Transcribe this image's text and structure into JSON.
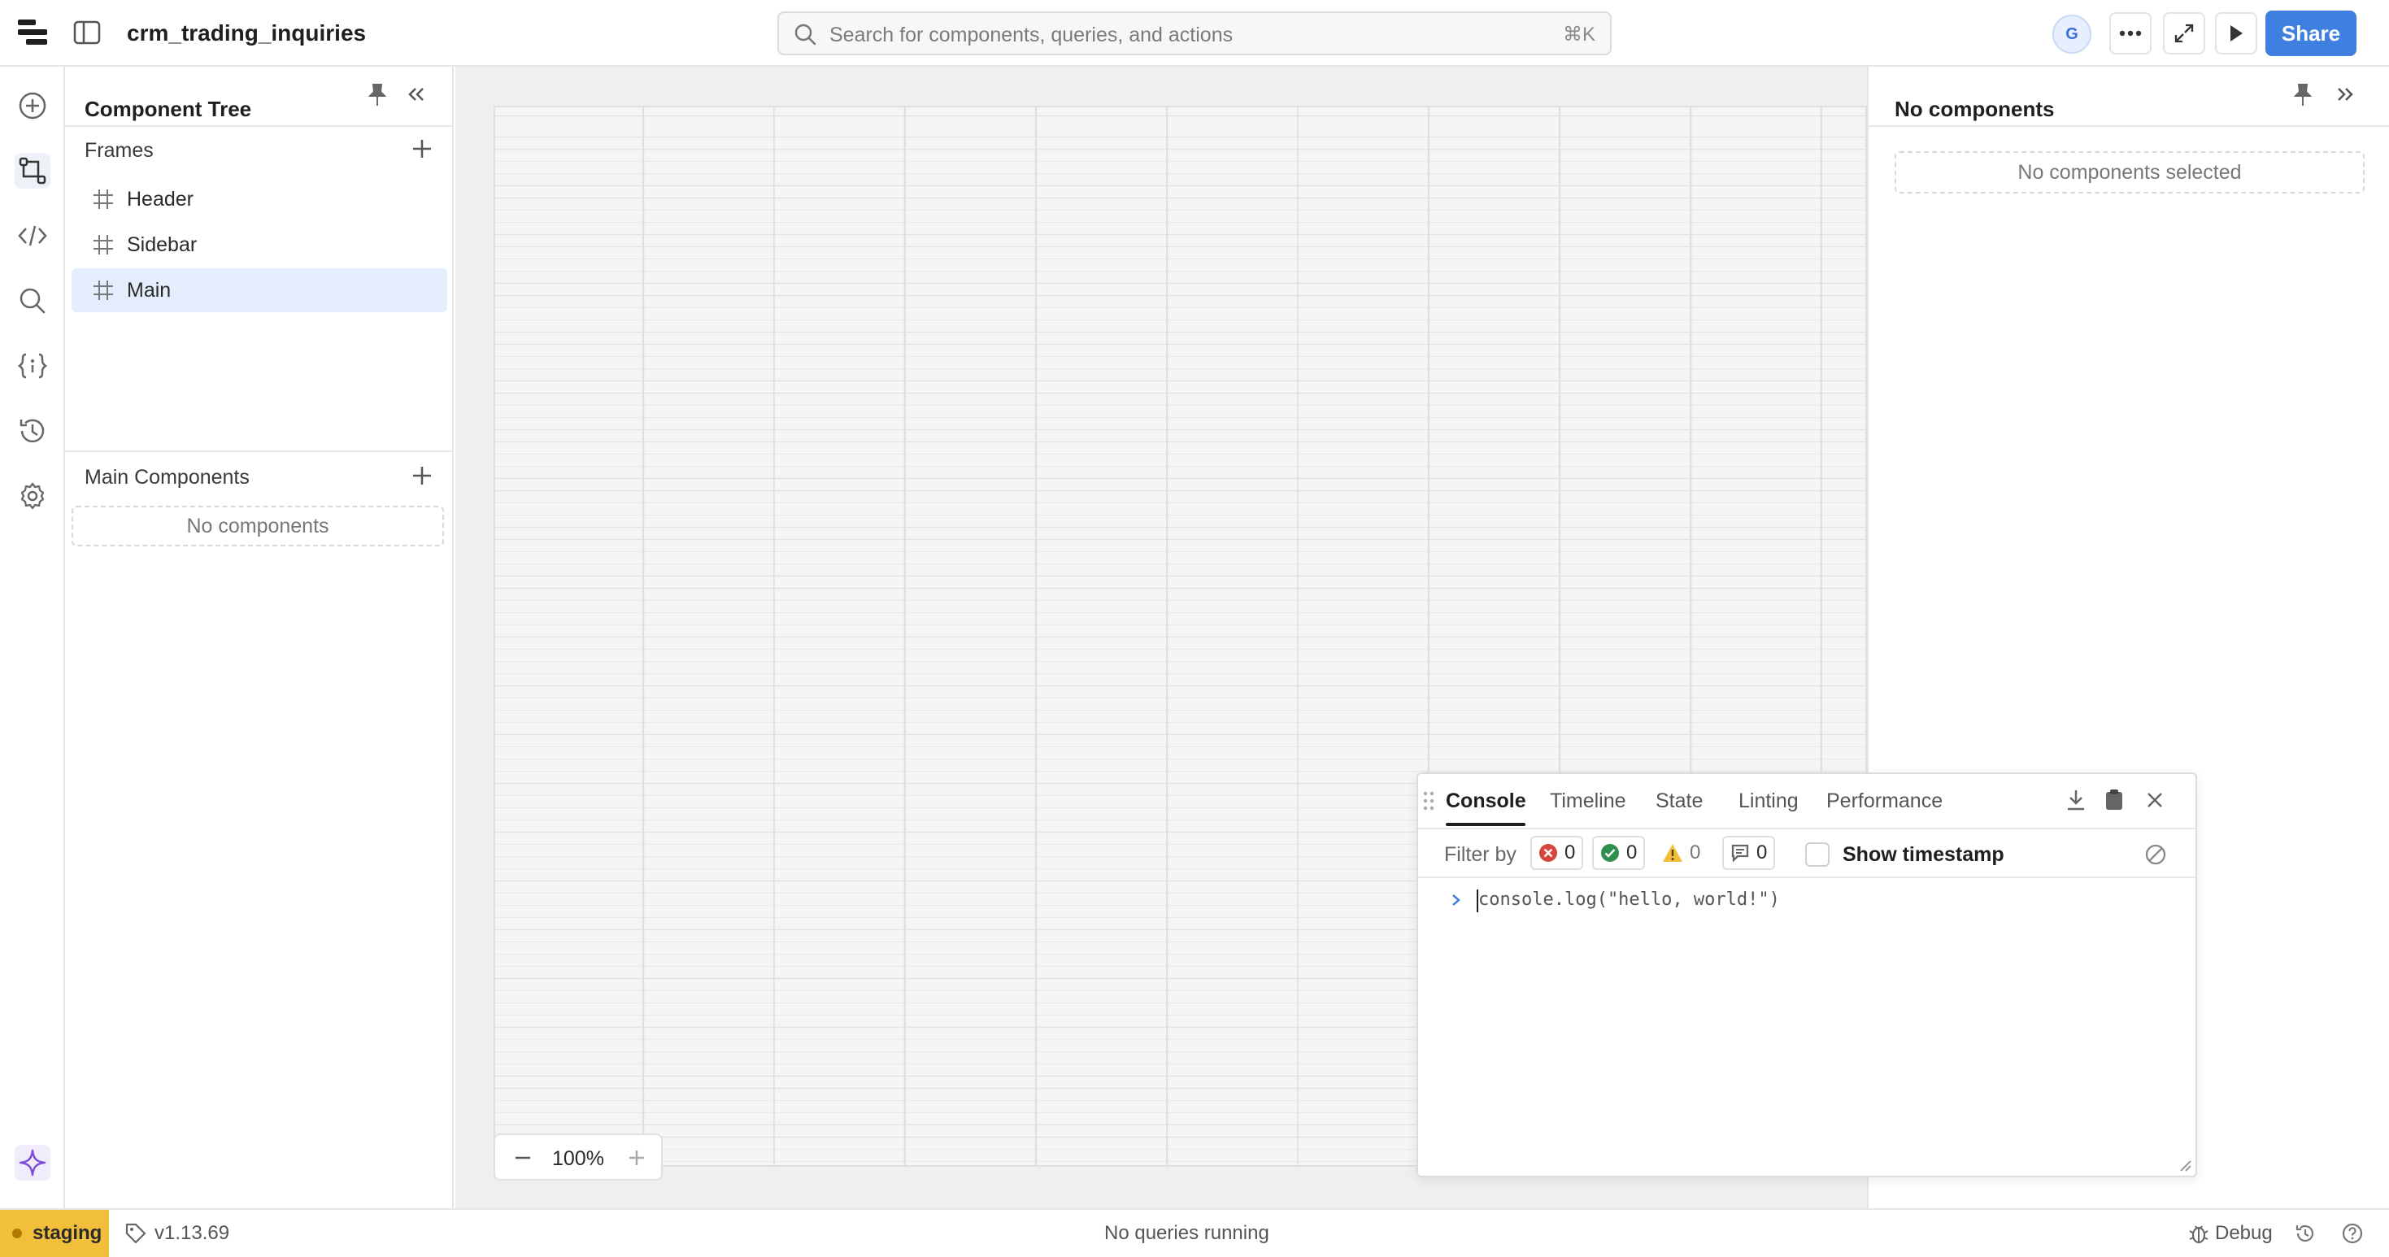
{
  "app": {
    "title": "crm_trading_inquiries"
  },
  "search": {
    "placeholder": "Search for components, queries, and actions",
    "shortcut": "⌘K"
  },
  "header": {
    "avatar_initial": "G",
    "share_label": "Share"
  },
  "tree_panel": {
    "title": "Component Tree",
    "frames_title": "Frames",
    "frames": [
      {
        "label": "Header"
      },
      {
        "label": "Sidebar"
      },
      {
        "label": "Main"
      }
    ],
    "main_components_title": "Main Components",
    "main_components_empty": "No components"
  },
  "canvas": {
    "zoom": "100%"
  },
  "inspector": {
    "title": "No components",
    "empty_label": "No components selected"
  },
  "console": {
    "tabs": [
      "Console",
      "Timeline",
      "State",
      "Linting",
      "Performance"
    ],
    "filter_label": "Filter by",
    "counts": {
      "errors": "0",
      "success": "0",
      "warnings": "0",
      "messages": "0"
    },
    "show_timestamp_label": "Show timestamp",
    "code": "console.log(\"hello, world!\")"
  },
  "statusbar": {
    "environment": "staging",
    "version": "v1.13.69",
    "queries_status": "No queries running",
    "debug_label": "Debug"
  },
  "colors": {
    "accent": "#3f7fe0",
    "selected_bg": "#e4edfb",
    "environment": "#f2bf3a"
  }
}
